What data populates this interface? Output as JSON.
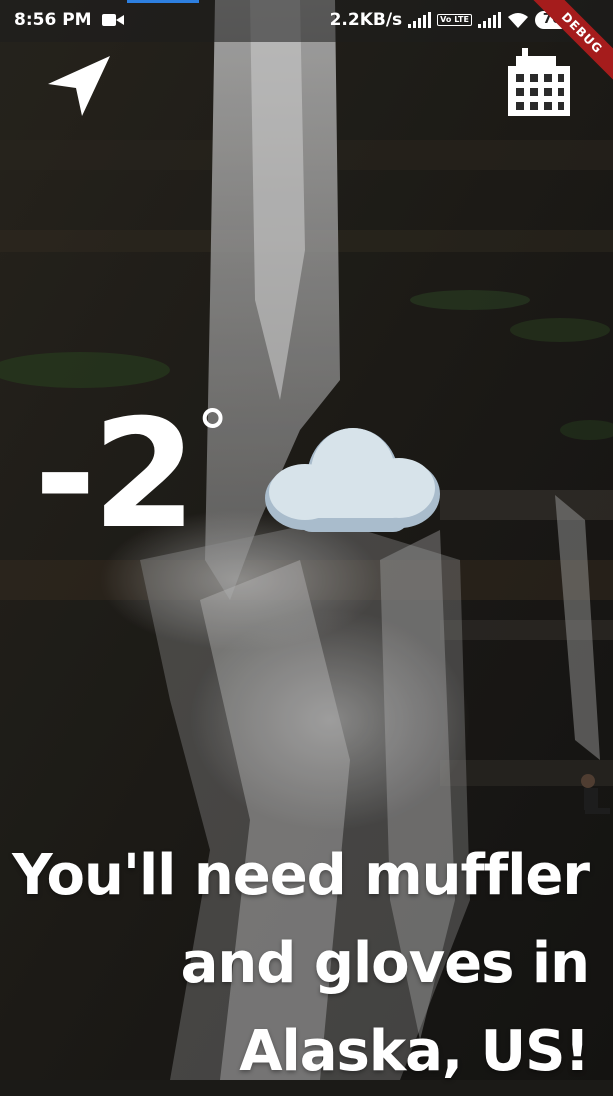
{
  "status_bar": {
    "time": "8:56 PM",
    "net_speed": "2.2KB/s",
    "volte": "Vo LTE",
    "battery": "76"
  },
  "debug_banner": "DEBUG",
  "weather": {
    "temperature": "-2",
    "degree_symbol": "°",
    "condition_icon": "cloud-icon"
  },
  "message": {
    "line1": "You'll need muffler",
    "line2": "and gloves in",
    "line3": "Alaska, US!"
  },
  "icons": {
    "location": "navigation-arrow-icon",
    "city": "city-building-icon"
  }
}
